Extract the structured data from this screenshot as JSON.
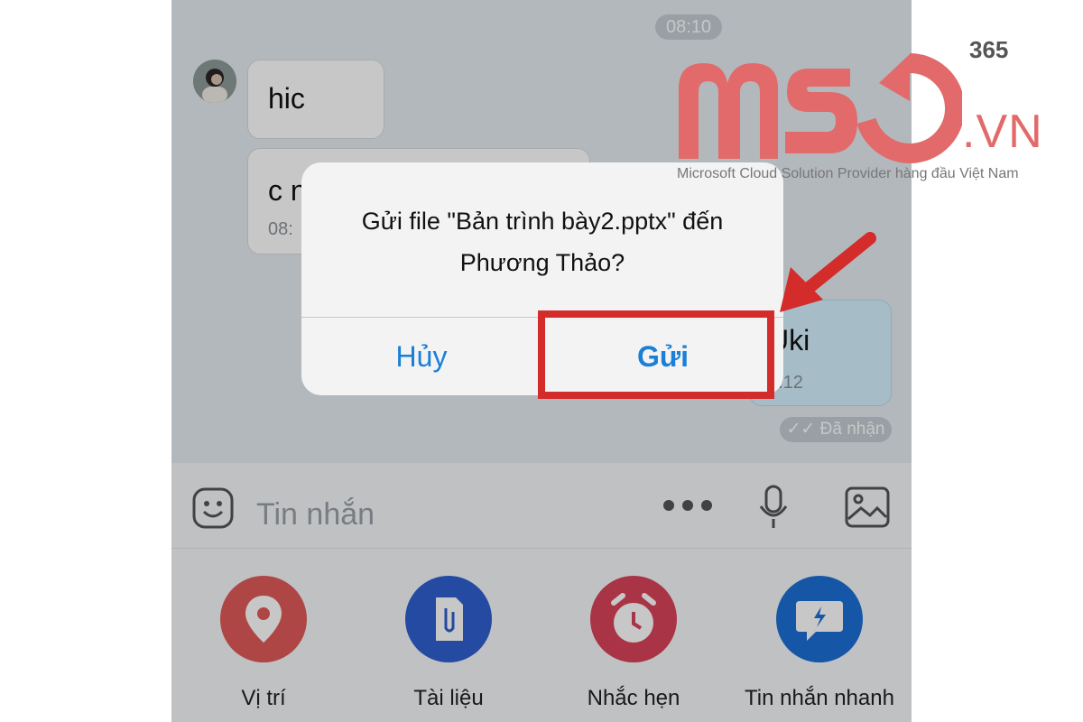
{
  "chat": {
    "time_separator": "08:10",
    "messages": [
      {
        "text": "hic"
      },
      {
        "text": "c n",
        "time": "08:"
      },
      {
        "text": "Uki",
        "time": "8:12"
      }
    ],
    "status": "Đã nhận"
  },
  "dialog": {
    "message_line1": "Gửi file \"Bản trình bày2.pptx\" đến",
    "message_line2": "Phương Thảo?",
    "cancel_label": "Hủy",
    "send_label": "Gửi"
  },
  "input_bar": {
    "placeholder": "Tin nhắn",
    "icons": [
      "emoji-icon",
      "more-dots-icon",
      "microphone-icon",
      "image-icon"
    ]
  },
  "actions": [
    {
      "label": "Vị trí",
      "icon": "location-pin-icon",
      "color": "#e05a5a"
    },
    {
      "label": "Tài liệu",
      "icon": "document-clip-icon",
      "color": "#2f5fd0"
    },
    {
      "label": "Nhắc hẹn",
      "icon": "alarm-clock-icon",
      "color": "#d9435a"
    },
    {
      "label": "Tin nhắn nhanh",
      "icon": "quick-message-icon",
      "color": "#1b6fd6"
    }
  ],
  "brand": {
    "logo_text": "MSO",
    "superscript": "365",
    "domain": ".VN",
    "tagline": "Microsoft Cloud Solution Provider hàng đầu Việt Nam",
    "color": "#e26a6a"
  },
  "annotation": {
    "highlight_color": "#d42b2b"
  }
}
